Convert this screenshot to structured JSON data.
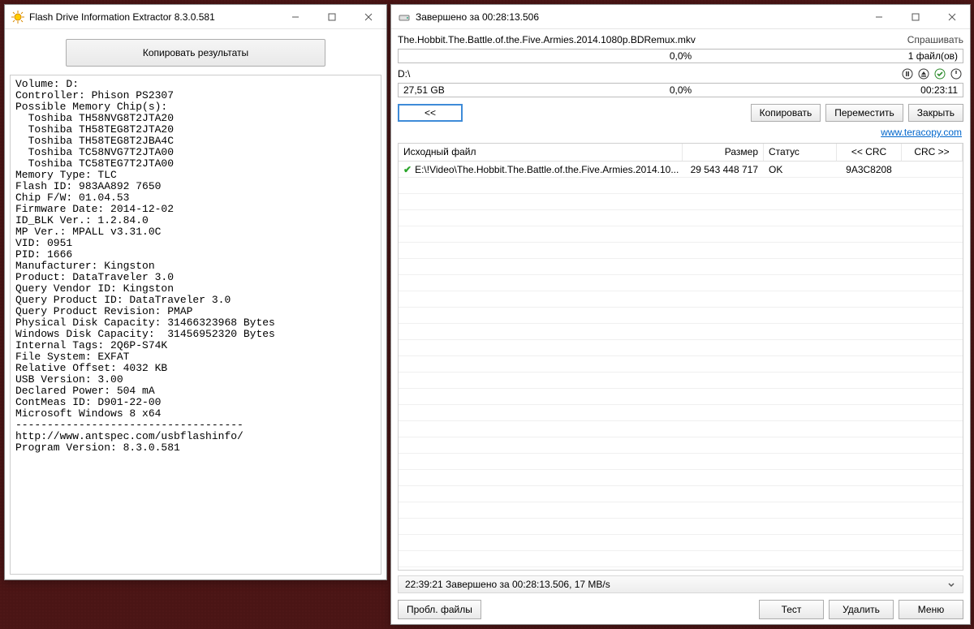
{
  "flash_info": {
    "title": "Flash Drive Information Extractor 8.3.0.581",
    "copy_button": "Копировать результаты",
    "text": "Volume: D:\nController: Phison PS2307\nPossible Memory Chip(s):\n  Toshiba TH58NVG8T2JTA20\n  Toshiba TH58TEG8T2JTA20\n  Toshiba TH58TEG8T2JBA4C\n  Toshiba TC58NVG7T2JTA00\n  Toshiba TC58TEG7T2JTA00\nMemory Type: TLC\nFlash ID: 983AA892 7650\nChip F/W: 01.04.53\nFirmware Date: 2014-12-02\nID_BLK Ver.: 1.2.84.0\nMP Ver.: MPALL v3.31.0C\nVID: 0951\nPID: 1666\nManufacturer: Kingston\nProduct: DataTraveler 3.0\nQuery Vendor ID: Kingston\nQuery Product ID: DataTraveler 3.0\nQuery Product Revision: PMAP\nPhysical Disk Capacity: 31466323968 Bytes\nWindows Disk Capacity:  31456952320 Bytes\nInternal Tags: 2Q6P-S74K\nFile System: EXFAT\nRelative Offset: 4032 KB\nUSB Version: 3.00\nDeclared Power: 504 mA\nContMeas ID: D901-22-00\nMicrosoft Windows 8 x64\n------------------------------------\nhttp://www.antspec.com/usbflashinfo/\nProgram Version: 8.3.0.581"
  },
  "teracopy": {
    "title": "Завершено за 00:28:13.506",
    "filename": "The.Hobbit.The.Battle.of.the.Five.Armies.2014.1080p.BDRemux.mkv",
    "ask": "Спрашивать",
    "progress1": {
      "pct": "0,0%",
      "right": "1 файл(ов)"
    },
    "drive": "D:\\",
    "progress2": {
      "left": "27,51 GB",
      "pct": "0,0%",
      "right": "00:23:11"
    },
    "nav_back": "<<",
    "btn_copy": "Копировать",
    "btn_move": "Переместить",
    "btn_close": "Закрыть",
    "url": "www.teracopy.com",
    "table": {
      "columns": {
        "file": "Исходный файл",
        "size": "Размер",
        "status": "Статус",
        "crc1": "<< CRC",
        "crc2": "CRC >>"
      },
      "rows": [
        {
          "file": "E:\\!Video\\The.Hobbit.The.Battle.of.the.Five.Armies.2014.10...",
          "size": "29 543 448 717",
          "status": "OK",
          "crc1": "9A3C8208",
          "crc2": ""
        }
      ]
    },
    "status_line": "22:39:21 Завершено за 00:28:13.506, 17 MB/s",
    "bottom": {
      "problem": "Пробл. файлы",
      "test": "Тест",
      "delete": "Удалить",
      "menu": "Меню"
    }
  }
}
